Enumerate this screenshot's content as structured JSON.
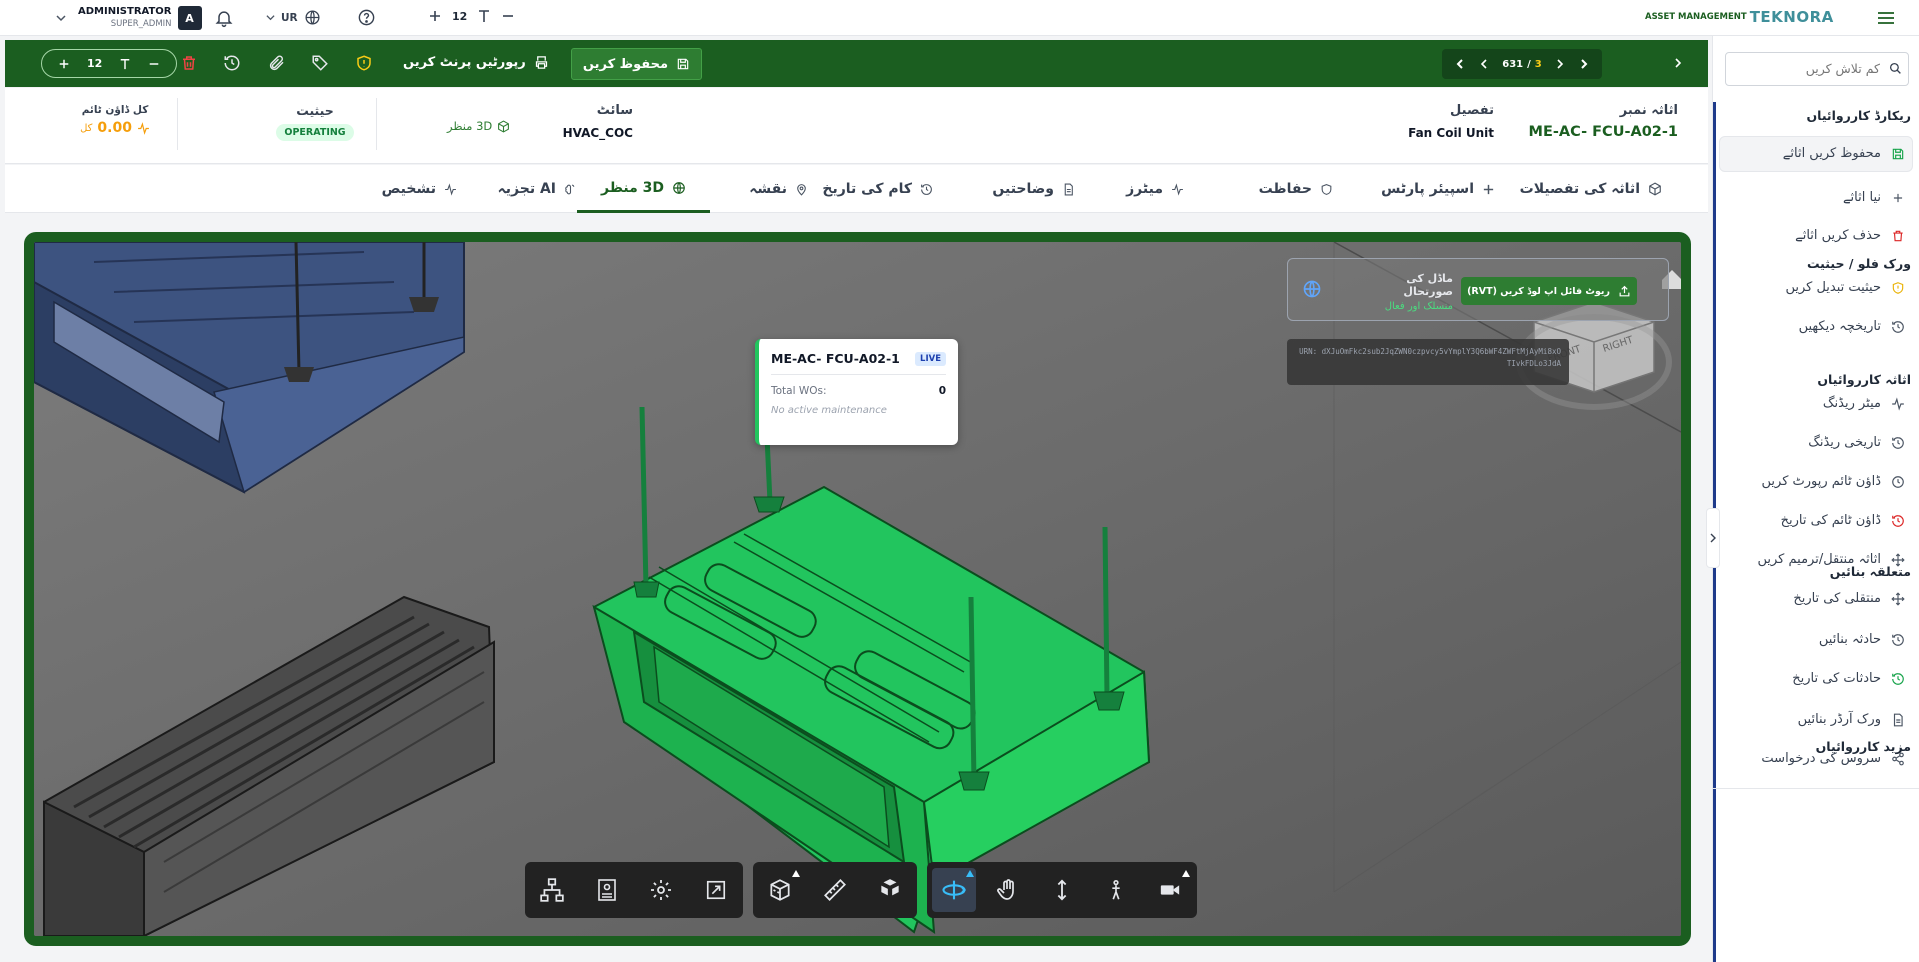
{
  "brand": {
    "name": "TEKNORA",
    "tag": "ASSET MANAGEMENT"
  },
  "topbar": {
    "font_size": "12",
    "language": "UR",
    "user_name": "ADMINISTRATOR",
    "user_role": "SUPER_ADMIN",
    "avatar": "A"
  },
  "sidebar": {
    "search_placeholder": "کم تلاش کریں",
    "sections": [
      {
        "title": "ریکارڈ کارروائیاں",
        "items": [
          {
            "label": "محفوظ کریں اثاثے",
            "icon": "save-icon"
          },
          {
            "label": "نیا اثاثے",
            "icon": "plus-icon"
          },
          {
            "label": "حذف کریں اثاثے",
            "icon": "trash-icon"
          }
        ]
      },
      {
        "title": "ورک فلو / حیثیت",
        "items": [
          {
            "label": "حیثیت تبدیل کریں",
            "icon": "shield-icon"
          },
          {
            "label": "تاریخچہ دیکھیں",
            "icon": "history-icon"
          }
        ]
      },
      {
        "title": "اثاثہ کارروائیاں",
        "items": [
          {
            "label": "میٹر ریڈنگ",
            "icon": "activity-icon"
          },
          {
            "label": "تاریخی ریڈنگ",
            "icon": "history-icon"
          },
          {
            "label": "ڈاؤن ٹائم رپورٹ کریں",
            "icon": "clock-icon"
          },
          {
            "label": "ڈاؤن ٹائم کی تاریخ",
            "icon": "history-icon"
          },
          {
            "label": "اثاثہ منتقل/ترمیم کریں",
            "icon": "move-icon"
          },
          {
            "label": "منتقلی کی تاریخ",
            "icon": "move-icon"
          }
        ]
      },
      {
        "title": "متعلقہ بنائیں",
        "items": [
          {
            "label": "حادثہ بنائیں",
            "icon": "history-icon"
          },
          {
            "label": "حادثات کی تاریخ",
            "icon": "history-icon"
          },
          {
            "label": "ورک آرڈر بنائیں",
            "icon": "document-icon"
          },
          {
            "label": "سروس کی درخواست",
            "icon": "share-icon"
          }
        ]
      },
      {
        "title": "مزید کارروائیاں",
        "items": []
      }
    ]
  },
  "action_bar": {
    "save_label": "محفوظ کریں",
    "print_label": "رپورٹیں پرنٹ کریں",
    "font_size": "12",
    "pager": {
      "current": "631",
      "separator": "/",
      "total": "3"
    }
  },
  "info": {
    "asset_number_label": "اثاثہ نمبر",
    "asset_number": "ME-AC- FCU-A02-1",
    "description_label": "تفصیل",
    "description": "Fan Coil Unit",
    "site_label": "سائٹ",
    "site": "HVAC_COC",
    "view3d": "3D منظر",
    "status_label": "حیثیت",
    "status": "OPERATING",
    "downtime_label": "کل ڈاؤن ٹائم",
    "downtime_value": "0.00",
    "downtime_unit": "کل"
  },
  "tabs": [
    {
      "label": "اثاثہ کی تفصیلات",
      "icon": "box-icon"
    },
    {
      "label": "اسپیئر پارٹس",
      "icon": "plus-icon"
    },
    {
      "label": "حفاظت",
      "icon": "shield-icon"
    },
    {
      "label": "میٹرز",
      "icon": "activity-icon"
    },
    {
      "label": "وضاحتیں",
      "icon": "document-icon"
    },
    {
      "label": "کام کی تاریخ",
      "icon": "history-icon"
    },
    {
      "label": "نقشہ",
      "icon": "map-pin-icon"
    },
    {
      "label": "3D منظر",
      "icon": "globe-icon",
      "active": true
    },
    {
      "label": "AI تجزیہ",
      "icon": "brain-icon"
    },
    {
      "label": "تشخیص",
      "icon": "activity-icon"
    }
  ],
  "viewer": {
    "upload_label": "ریوٹ فائل اپ لوڈ کریں (RVT)",
    "model_status_label": "ماڈل کی صورتحال",
    "model_status_value": "منسلک اور فعال",
    "urn": "URN: dXJuOmFkc2sub2JqZWN0czpvcy5vYmplY3Q6bWF4ZWFtMjAyMi8xOTIvkFDLo3JdA",
    "popup": {
      "asset": "ME-AC- FCU-A02-1",
      "badge": "LIVE",
      "total_label": "Total WOs:",
      "total_value": "0",
      "note": "No active maintenance"
    },
    "cube_labels": [
      "FRONT",
      "RIGHT"
    ]
  },
  "colors": {
    "primary": "#1b5e20",
    "button": "#2e7d32",
    "highlight": "#22c55e",
    "status_bg": "#dcfce7",
    "status_text": "#15803d",
    "accent_blue": "#1e3a8a"
  }
}
